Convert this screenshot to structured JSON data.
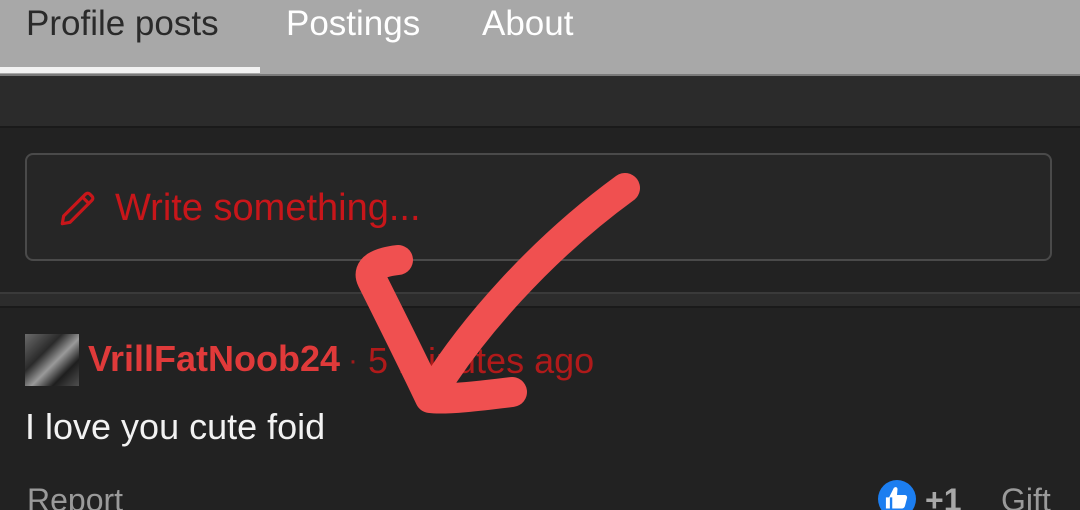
{
  "tabs": [
    {
      "label": "Profile posts",
      "active": true
    },
    {
      "label": "Postings",
      "active": false
    },
    {
      "label": "About",
      "active": false
    }
  ],
  "composer": {
    "placeholder": "Write something...",
    "icon": "pencil-icon"
  },
  "post": {
    "username": "VrillFatNoob24",
    "separator": "·",
    "time_ago": "5 minutes ago",
    "body": "I love you cute foid",
    "report_label": "Report",
    "like_count": "+1",
    "gift_label": "Gift",
    "like_icon": "thumbs-up-icon"
  },
  "colors": {
    "accent_red": "#c8161a",
    "username_red": "#e03a3a",
    "like_blue": "#1c7ef0",
    "annotation_red": "#f05050"
  }
}
